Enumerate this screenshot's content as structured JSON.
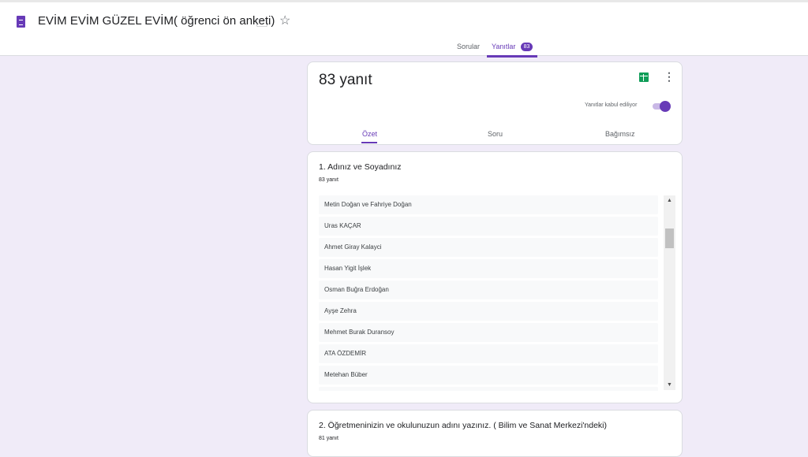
{
  "header": {
    "title": "EVİM EVİM GÜZEL EVİM( öğrenci ön anketi)",
    "tabs": [
      {
        "label": "Sorular"
      },
      {
        "label": "Yanıtlar",
        "badge": "83"
      }
    ]
  },
  "summary": {
    "count_label": "83 yanıt",
    "accepting_label": "Yanıtlar kabul ediliyor",
    "accepting": true,
    "subtabs": [
      "Özet",
      "Soru",
      "Bağımsız"
    ]
  },
  "questions": [
    {
      "title": "1. Adınız ve Soyadınız",
      "count": "83 yanıt",
      "answers": [
        "Metin Doğan ve Fahriye Doğan",
        "Uras KAÇAR",
        "Ahmet Giray Kalayci",
        "Hasan Yigit İşlek",
        "Osman Buğra Erdoğan",
        "Ayşe Zehra",
        "Mehmet Burak Duransoy",
        "ATA ÖZDEMİR",
        "Metehan Büber"
      ]
    },
    {
      "title": "2. Öğretmeninizin ve okulunuzun adını yazınız. ( Bilim ve Sanat Merkezi'ndeki)",
      "count": "81 yanıt"
    }
  ],
  "colors": {
    "accent": "#673ab7",
    "background": "#f0ebf8",
    "sheets": "#0f9d58"
  }
}
